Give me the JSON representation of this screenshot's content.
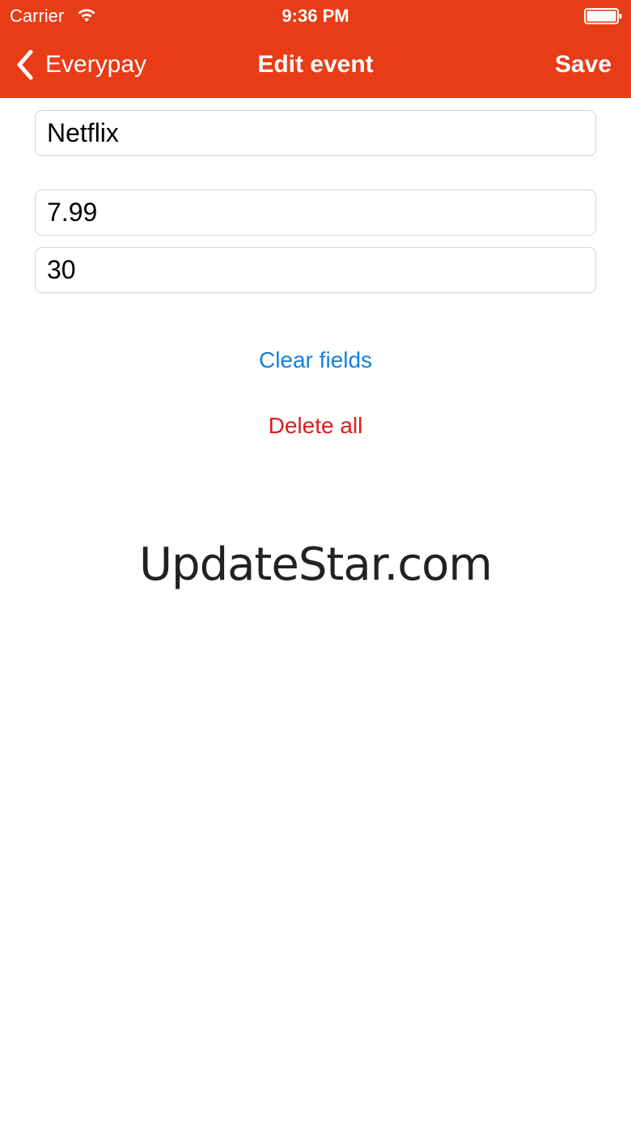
{
  "status_bar": {
    "carrier": "Carrier",
    "time": "9:36 PM",
    "icons": [
      "wifi-icon",
      "battery-icon"
    ]
  },
  "nav": {
    "back_label": "Everypay",
    "back_icon": "chevron-left-icon",
    "title": "Edit event",
    "save_label": "Save",
    "bar_color": "#e83c16"
  },
  "form": {
    "name_value": "Netflix",
    "amount_value": "7.99",
    "days_value": "30"
  },
  "actions": {
    "clear_label": "Clear fields",
    "clear_color": "#1a7fd6",
    "delete_label": "Delete all",
    "delete_color": "#e01b1b"
  },
  "watermark": "UpdateStar.com"
}
